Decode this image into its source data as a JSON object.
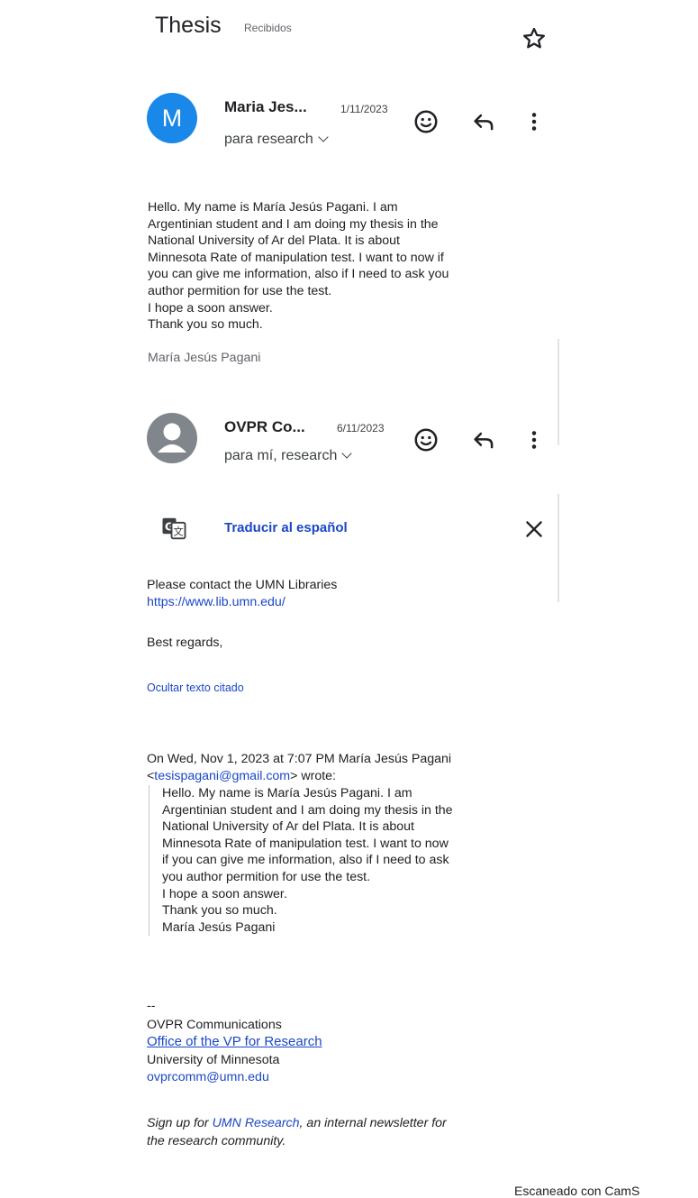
{
  "thread": {
    "subject": "Thesis",
    "label": "Recibidos"
  },
  "message1": {
    "avatar_letter": "M",
    "sender": "Maria Jes...",
    "date": "1/11/2023",
    "recipients": "para research",
    "body": "Hello. My name is María Jesús Pagani. I am\nArgentinian student and I am doing my thesis in the\nNational University of Ar del Plata. It is about\nMinnesota Rate of manipulation test. I want to now if\nyou can give me information, also if I need to ask you\nauthor permition for use the test.\nI hope a soon answer.\nThank you so much.",
    "signature": "María Jesús Pagani"
  },
  "message2": {
    "sender": "OVPR Co...",
    "date": "6/11/2023",
    "recipients": "para mí, research",
    "translate_label": "Traducir al español",
    "body_line1": "Please contact the UMN Libraries",
    "body_link": "https://www.lib.umn.edu/",
    "regards": "Best regards,",
    "hide_quoted": "Ocultar texto citado",
    "quote_header_line1": "On Wed, Nov 1, 2023 at 7:07 PM María Jesús Pagani",
    "quote_email": "tesispagani@gmail.com",
    "quote_header_wrote": " wrote:",
    "quoted_body": "Hello. My name is María Jesús Pagani. I am\nArgentinian student and I am doing my thesis in the\nNational University of Ar del Plata. It is about\nMinnesota Rate of manipulation test. I want to now\nif you can give me information, also if I need to ask\nyou author permition for use the test.\nI hope a soon answer.\nThank you so much.\nMaría Jesús Pagani",
    "sig_dash": "--",
    "sig_org": "OVPR Communications",
    "sig_office": "Office of the VP for Research",
    "sig_university": "University of Minnesota",
    "sig_email": "ovprcomm@umn.edu",
    "newsletter_pre": "Sign up for ",
    "newsletter_link": "UMN Research",
    "newsletter_post": ", an internal newsletter for",
    "newsletter_line2": "the research community."
  },
  "footer": {
    "scanner_text": "Escaneado con CamS"
  },
  "icons": [
    "star-icon",
    "emoji-icon",
    "reply-icon",
    "more-vert-icon",
    "person-icon",
    "translate-icon",
    "close-icon"
  ],
  "colors": {
    "avatar_blue": "#1a88e8",
    "avatar_gray": "#80868b",
    "link_blue": "#1a47c7"
  }
}
